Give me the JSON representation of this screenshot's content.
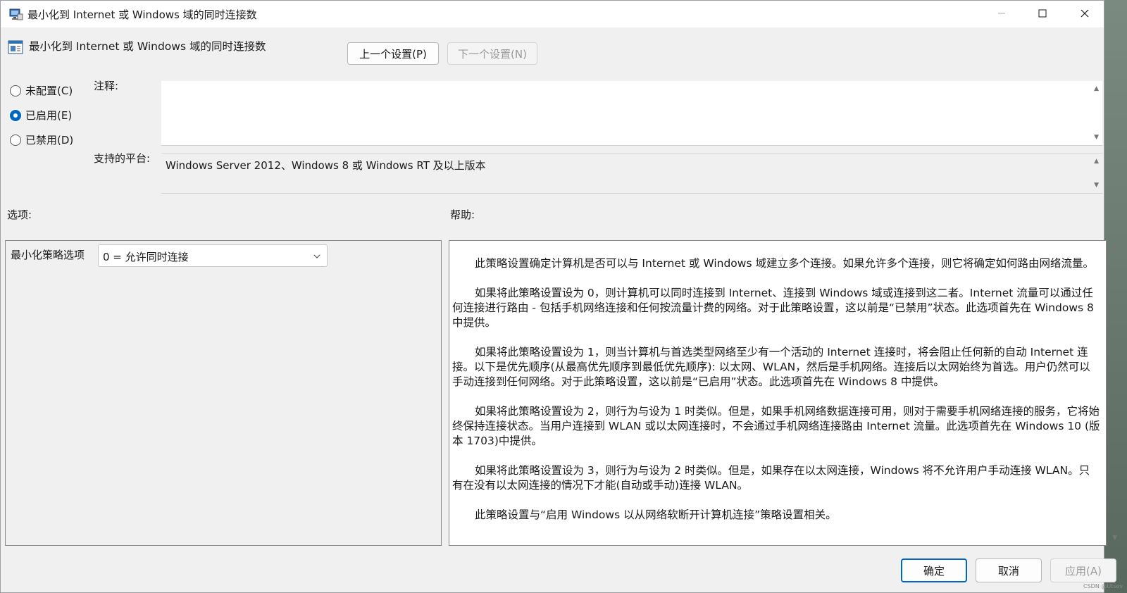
{
  "window": {
    "title": "最小化到 Internet 或 Windows 域的同时连接数"
  },
  "header": {
    "policy_title": "最小化到 Internet 或 Windows 域的同时连接数",
    "prev_label": "上一个设置(P)",
    "next_label": "下一个设置(N)"
  },
  "state": {
    "options": [
      {
        "label": "未配置(C)",
        "selected": false
      },
      {
        "label": "已启用(E)",
        "selected": true
      },
      {
        "label": "已禁用(D)",
        "selected": false
      }
    ]
  },
  "comment": {
    "label": "注释:",
    "value": ""
  },
  "platform": {
    "label": "支持的平台:",
    "value": "Windows Server 2012、Windows 8 或 Windows RT 及以上版本"
  },
  "options_section": {
    "label": "选项:",
    "policy_option_label": "最小化策略选项",
    "selected_value": "0 = 允许同时连接"
  },
  "help_section": {
    "label": "帮助:",
    "paragraphs": [
      "此策略设置确定计算机是否可以与 Internet 或 Windows 域建立多个连接。如果允许多个连接，则它将确定如何路由网络流量。",
      "如果将此策略设置设为 0，则计算机可以同时连接到 Internet、连接到 Windows 域或连接到这二者。Internet 流量可以通过任何连接进行路由 - 包括手机网络连接和任何按流量计费的网络。对于此策略设置，这以前是“已禁用”状态。此选项首先在 Windows 8 中提供。",
      "如果将此策略设置设为 1，则当计算机与首选类型网络至少有一个活动的 Internet 连接时，将会阻止任何新的自动 Internet 连接。以下是优先顺序(从最高优先顺序到最低优先顺序): 以太网、WLAN，然后是手机网络。连接后以太网始终为首选。用户仍然可以手动连接到任何网络。对于此策略设置，这以前是“已启用”状态。此选项首先在 Windows 8 中提供。",
      "如果将此策略设置设为 2，则行为与设为 1 时类似。但是，如果手机网络数据连接可用，则对于需要手机网络连接的服务，它将始终保持连接状态。当用户连接到 WLAN 或以太网连接时，不会通过手机网络连接路由 Internet 流量。此选项首先在 Windows 10 (版本 1703)中提供。",
      "如果将此策略设置设为 3，则行为与设为 2 时类似。但是，如果存在以太网连接，Windows 将不允许用户手动连接 WLAN。只有在没有以太网连接的情况下才能(自动或手动)连接 WLAN。",
      "此策略设置与“启用 Windows 以从网络软断开计算机连接”策略设置相关。"
    ]
  },
  "footer": {
    "ok_label": "确定",
    "cancel_label": "取消",
    "apply_label": "应用(A)",
    "watermark": "CSDN @Utsev"
  },
  "colors": {
    "accent": "#0067c0",
    "window_bg": "#f0f0f0"
  },
  "icons": [
    "policy-app-icon",
    "minimize-icon",
    "maximize-icon",
    "close-icon",
    "policy-setting-icon",
    "chevron-down-icon",
    "scroll-up-icon",
    "scroll-down-icon"
  ]
}
